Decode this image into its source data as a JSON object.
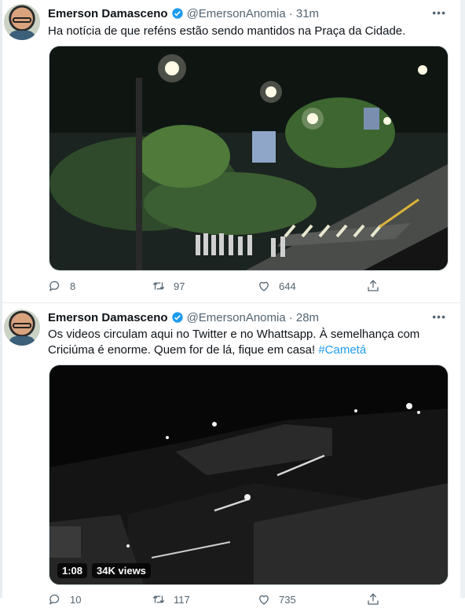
{
  "tweets": [
    {
      "name": "Emerson Damasceno",
      "handle": "@EmersonAnomia",
      "time": "· 31m",
      "text": "Ha notícia de que reféns estão sendo mantidos na Praça da Cidade.",
      "replies": "8",
      "retweets": "97",
      "likes": "644"
    },
    {
      "name": "Emerson Damasceno",
      "handle": "@EmersonAnomia",
      "time": "· 28m",
      "text_line1": "Os videos circulam aqui no Twitter e no Whattsapp. À semelhança com",
      "text_line2": "Criciúma é enorme. Quem for de lá, fique em casa!",
      "hashtag": "#Cametá",
      "video_duration": "1:08",
      "video_views": "34K views",
      "replies": "10",
      "retweets": "117",
      "likes": "735"
    }
  ],
  "icons": {
    "more": "more-dots-icon",
    "reply": "reply-icon",
    "retweet": "retweet-icon",
    "like": "heart-icon",
    "share": "share-icon",
    "verified": "verified-badge-icon"
  },
  "colors": {
    "accent": "#1d9bf0",
    "muted": "#536471",
    "text": "#0f1419"
  }
}
